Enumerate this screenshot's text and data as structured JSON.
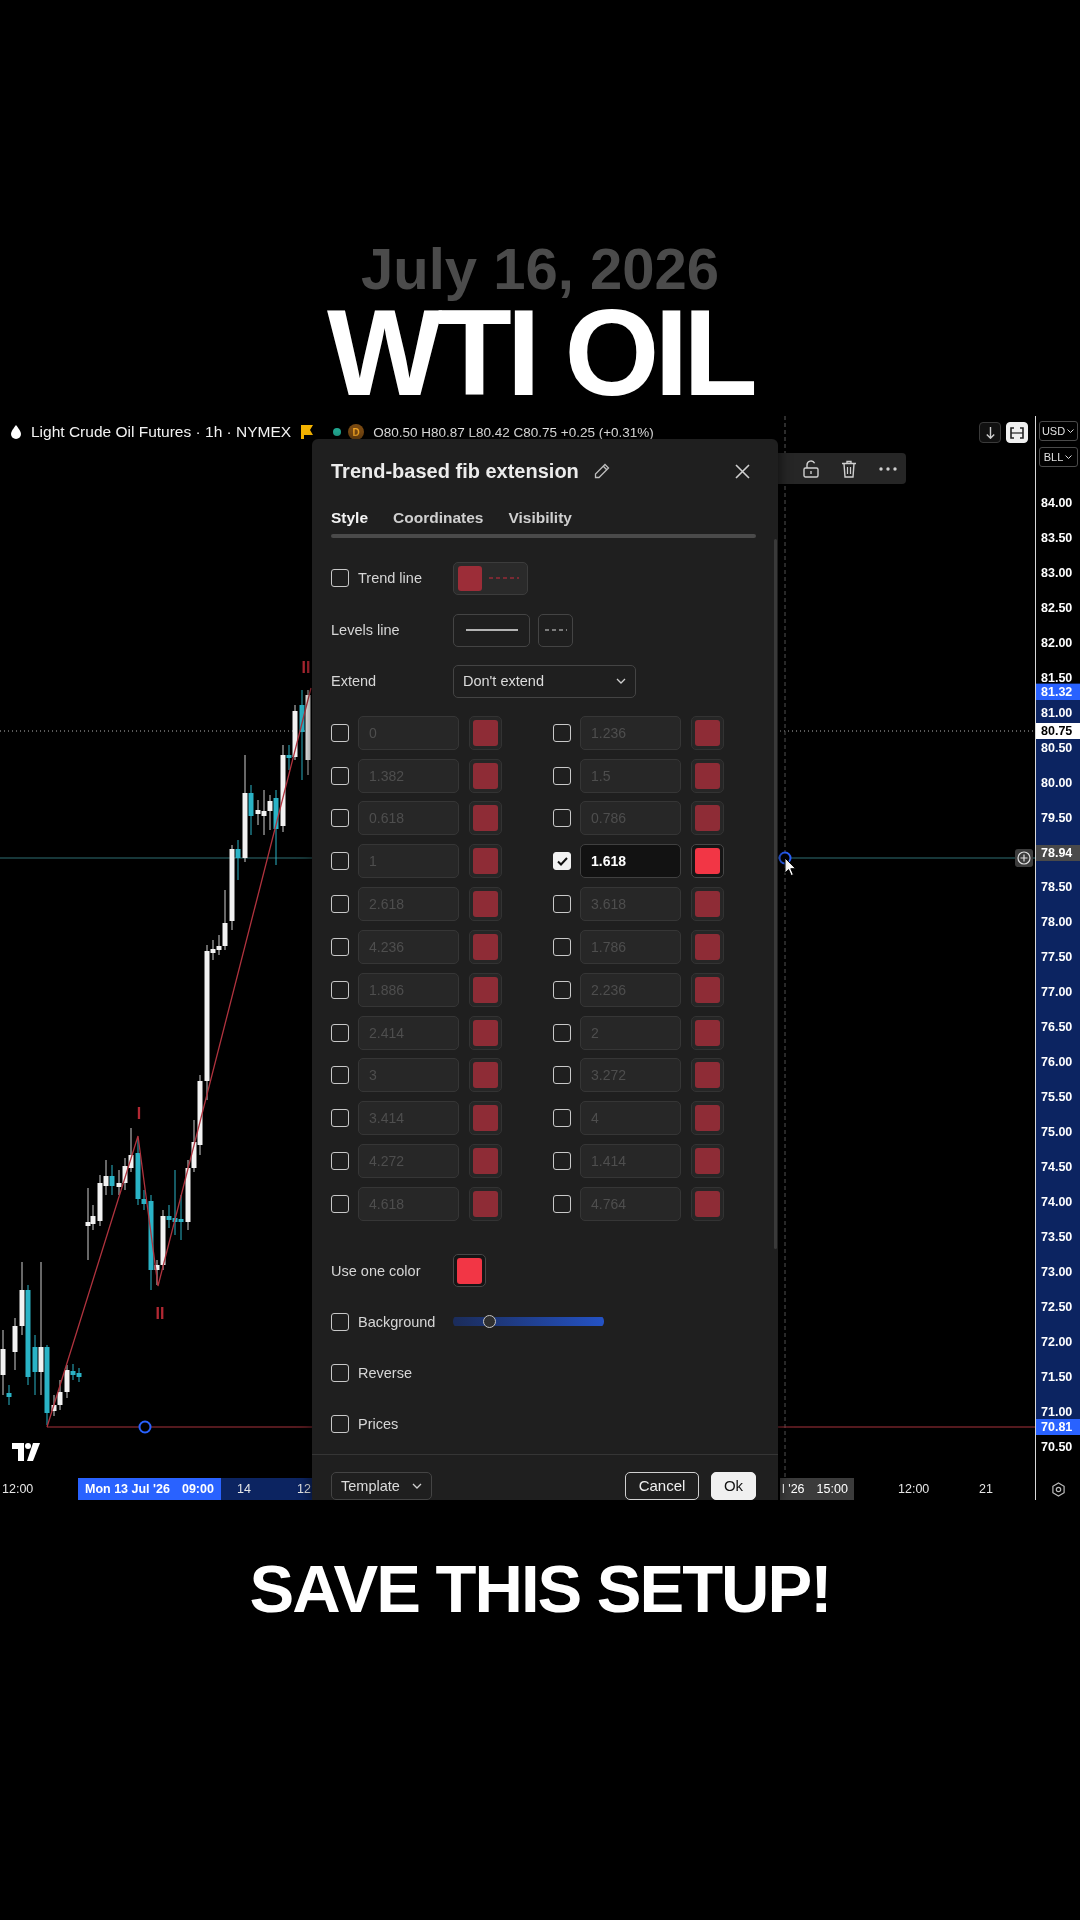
{
  "header": {
    "date": "July 16, 2026",
    "title": "WTI OIL"
  },
  "chart": {
    "legend": {
      "symbol": "Light Crude Oil Futures · 1h · NYMEX",
      "badge": "D",
      "ohlc": "O80.50 H80.87 L80.42 C80.75 +0.25 (+0.31%)"
    },
    "wave_labels": [
      "II",
      "I",
      "II"
    ],
    "price_axis": {
      "currency": "USD",
      "unit": "BLL",
      "labels": [
        {
          "text": "84.00",
          "kind": "tick"
        },
        {
          "text": "83.50",
          "kind": "tick"
        },
        {
          "text": "83.00",
          "kind": "tick"
        },
        {
          "text": "82.50",
          "kind": "tick"
        },
        {
          "text": "82.00",
          "kind": "tick"
        },
        {
          "text": "81.50",
          "kind": "tick"
        },
        {
          "text": "81.00",
          "kind": "tick"
        },
        {
          "text": "80.50",
          "kind": "tick"
        },
        {
          "text": "80.00",
          "kind": "tick"
        },
        {
          "text": "79.50",
          "kind": "tick"
        },
        {
          "text": "78.94",
          "kind": "crosshair"
        },
        {
          "text": "78.50",
          "kind": "tick"
        },
        {
          "text": "78.00",
          "kind": "tick"
        },
        {
          "text": "77.50",
          "kind": "tick"
        },
        {
          "text": "77.00",
          "kind": "tick"
        },
        {
          "text": "76.50",
          "kind": "tick"
        },
        {
          "text": "76.00",
          "kind": "tick"
        },
        {
          "text": "75.50",
          "kind": "tick"
        },
        {
          "text": "75.00",
          "kind": "tick"
        },
        {
          "text": "74.50",
          "kind": "tick"
        },
        {
          "text": "74.00",
          "kind": "tick"
        },
        {
          "text": "73.50",
          "kind": "tick"
        },
        {
          "text": "73.00",
          "kind": "tick"
        },
        {
          "text": "72.50",
          "kind": "tick"
        },
        {
          "text": "72.00",
          "kind": "tick"
        },
        {
          "text": "71.50",
          "kind": "tick"
        },
        {
          "text": "71.00",
          "kind": "tick"
        },
        {
          "text": "70.50",
          "kind": "tick"
        }
      ],
      "tags": [
        {
          "text": "81.32",
          "kind": "range"
        },
        {
          "text": "80.75",
          "kind": "last"
        },
        {
          "text": "70.81",
          "kind": "range"
        }
      ]
    },
    "time_axis": {
      "labels": [
        {
          "kind": "tick",
          "text": "12:00"
        },
        {
          "kind": "range",
          "text": "Mon 13 Jul '26",
          "time": "09:00"
        },
        {
          "kind": "tick",
          "text": "14"
        },
        {
          "kind": "tick",
          "text": "12"
        },
        {
          "kind": "crosshair",
          "text": "l '26",
          "time": "15:00"
        },
        {
          "kind": "tick",
          "text": "12:00"
        },
        {
          "kind": "tick",
          "text": "21"
        }
      ]
    }
  },
  "dialog": {
    "title": "Trend-based fib extension",
    "tabs": [
      {
        "label": "Style",
        "selected": true
      },
      {
        "label": "Coordinates",
        "selected": false
      },
      {
        "label": "Visibility",
        "selected": false
      }
    ],
    "trend_line": {
      "label": "Trend line",
      "checked": false
    },
    "levels_line": {
      "label": "Levels line"
    },
    "extend": {
      "label": "Extend",
      "value": "Don't extend"
    },
    "levels": [
      {
        "value": "0",
        "checked": false
      },
      {
        "value": "1.236",
        "checked": false
      },
      {
        "value": "1.382",
        "checked": false
      },
      {
        "value": "1.5",
        "checked": false
      },
      {
        "value": "0.618",
        "checked": false
      },
      {
        "value": "0.786",
        "checked": false
      },
      {
        "value": "1",
        "checked": false
      },
      {
        "value": "1.618",
        "checked": true
      },
      {
        "value": "2.618",
        "checked": false
      },
      {
        "value": "3.618",
        "checked": false
      },
      {
        "value": "4.236",
        "checked": false
      },
      {
        "value": "1.786",
        "checked": false
      },
      {
        "value": "1.886",
        "checked": false
      },
      {
        "value": "2.236",
        "checked": false
      },
      {
        "value": "2.414",
        "checked": false
      },
      {
        "value": "2",
        "checked": false
      },
      {
        "value": "3",
        "checked": false
      },
      {
        "value": "3.272",
        "checked": false
      },
      {
        "value": "3.414",
        "checked": false
      },
      {
        "value": "4",
        "checked": false
      },
      {
        "value": "4.272",
        "checked": false
      },
      {
        "value": "1.414",
        "checked": false
      },
      {
        "value": "4.618",
        "checked": false
      },
      {
        "value": "4.764",
        "checked": false
      }
    ],
    "use_one_color": {
      "label": "Use one color"
    },
    "background": {
      "label": "Background",
      "checked": false,
      "level": 0.24
    },
    "reverse": {
      "label": "Reverse",
      "checked": false
    },
    "prices": {
      "label": "Prices",
      "checked": false
    },
    "template": {
      "label": "Template"
    },
    "buttons": [
      {
        "label": "Cancel",
        "kind": "secondary"
      },
      {
        "label": "Ok",
        "kind": "primary"
      }
    ]
  },
  "caption": "SAVE THIS SETUP!"
}
